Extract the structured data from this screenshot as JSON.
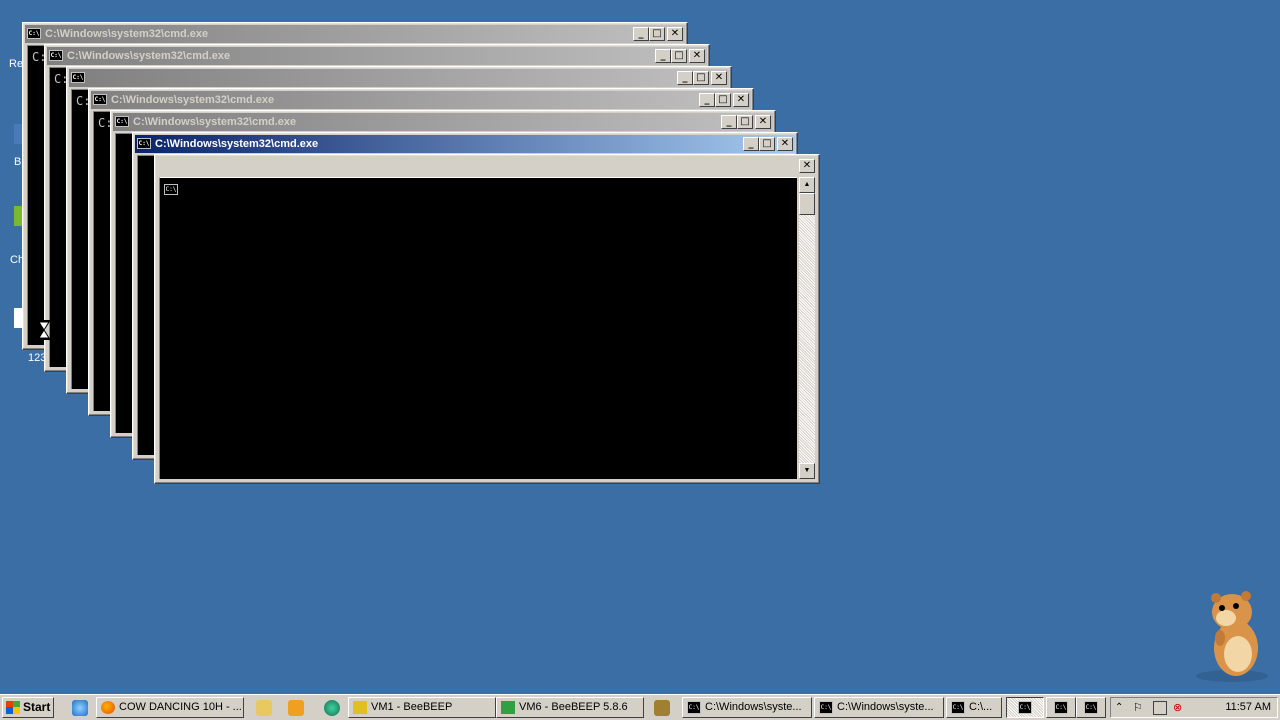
{
  "desktop": {
    "label_re": "Re",
    "label_b": "B",
    "label_ch": "Ch",
    "label_num": "123"
  },
  "windows": [
    {
      "title": "C:\\Windows\\system32\\cmd.exe",
      "prompt": "C:"
    },
    {
      "title": "C:\\Windows\\system32\\cmd.exe",
      "prompt": "C:"
    },
    {
      "title": "",
      "prompt": "C:"
    },
    {
      "title": "C:\\Windows\\system32\\cmd.exe",
      "prompt": "C:"
    },
    {
      "title": "C:\\Windows\\system32\\cmd.exe",
      "prompt": ""
    },
    {
      "title": "C:\\Windows\\system32\\cmd.exe",
      "prompt": ""
    },
    {
      "title": "",
      "prompt": ""
    }
  ],
  "window_buttons": {
    "minimize": "_",
    "maximize": "□",
    "close": "✕"
  },
  "cmd_icon_text": "C:\\",
  "taskbar": {
    "start_label": "Start",
    "tasks": [
      {
        "label": "COW DANCING 10H - ...",
        "icon": "firefox-icon"
      },
      {
        "label": "VM1 - BeeBEEP",
        "icon": "beebeep-icon"
      },
      {
        "label": "VM6 - BeeBEEP 5.8.6",
        "icon": "vm-icon"
      },
      {
        "label": "C:\\Windows\\syste...",
        "icon": "cmd-icon"
      },
      {
        "label": "C:\\Windows\\syste...",
        "icon": "cmd-icon"
      },
      {
        "label": "C:\\...",
        "icon": "cmd-icon"
      }
    ],
    "clock": "11:57 AM"
  },
  "colors": {
    "desktop": "#3a6ea5",
    "active_title": "#0a246a",
    "inactive_title": "#808080"
  }
}
